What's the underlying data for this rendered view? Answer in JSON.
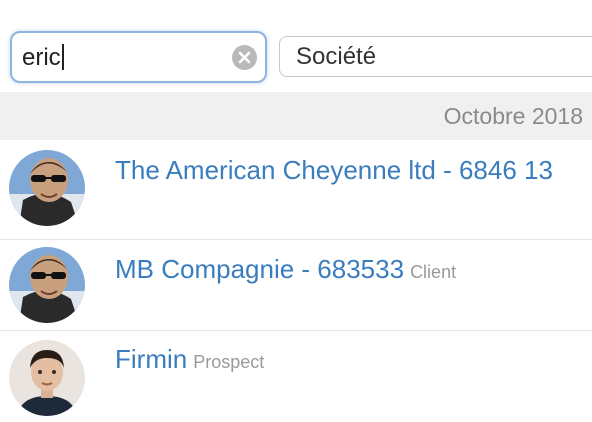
{
  "search": {
    "value": "eric"
  },
  "filter": {
    "label": "Société"
  },
  "section": {
    "title": "Octobre 2018"
  },
  "results": [
    {
      "name": "The American Cheyenne ltd - 6846 13",
      "tag": ""
    },
    {
      "name": "MB Compagnie - 683533",
      "tag": "Client"
    },
    {
      "name": "Firmin",
      "tag": "Prospect"
    }
  ],
  "colors": {
    "link": "#3a7dbf",
    "focus_border": "#8fb4e0",
    "header_bg": "#f0f0f0"
  },
  "icons": {
    "clear": "clear-circle-icon"
  }
}
